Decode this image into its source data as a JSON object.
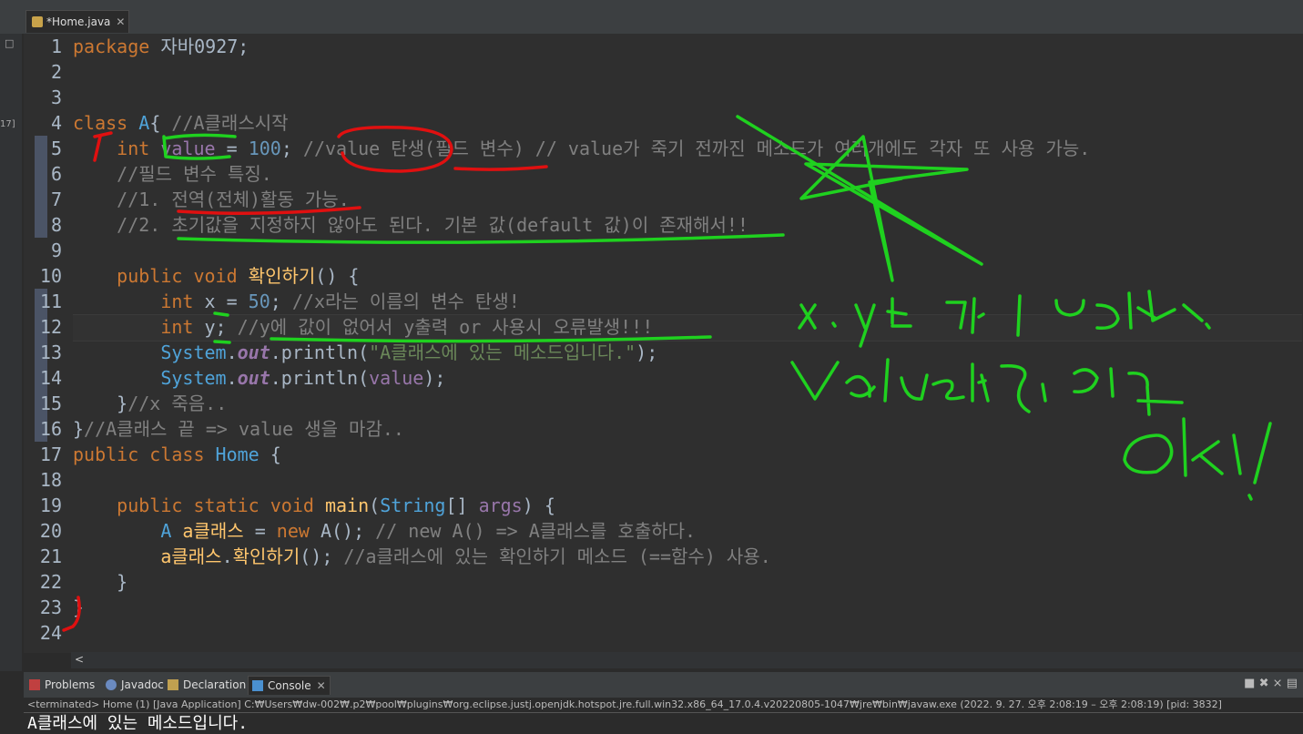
{
  "editor": {
    "tab_label": "*Home.java",
    "tab_close": "✕",
    "scroll_left": "<"
  },
  "lines": [
    {
      "n": "1",
      "parts": [
        [
          "kw",
          "package"
        ],
        [
          "loc",
          " 자바0927;"
        ]
      ]
    },
    {
      "n": "2",
      "parts": []
    },
    {
      "n": "3",
      "parts": []
    },
    {
      "n": "4",
      "parts": [
        [
          "kw",
          "class"
        ],
        [
          "loc",
          " "
        ],
        [
          "typ",
          "A"
        ],
        [
          "loc",
          "{ "
        ],
        [
          "cm",
          "//A클래스시작"
        ]
      ]
    },
    {
      "n": "5",
      "parts": [
        [
          "loc",
          "    "
        ],
        [
          "kw",
          "int"
        ],
        [
          "loc",
          " "
        ],
        [
          "fld",
          "value"
        ],
        [
          "loc",
          " = "
        ],
        [
          "num",
          "100"
        ],
        [
          "loc",
          "; "
        ],
        [
          "cm",
          "//value 탄생(필드 변수) // value가 죽기 전까진 메소드가 여러개에도 각자 또 사용 가능."
        ]
      ]
    },
    {
      "n": "6",
      "parts": [
        [
          "loc",
          "    "
        ],
        [
          "cm",
          "//필드 변수 특징."
        ]
      ]
    },
    {
      "n": "7",
      "parts": [
        [
          "loc",
          "    "
        ],
        [
          "cm",
          "//1. 전역(전체)활동 가능."
        ]
      ]
    },
    {
      "n": "8",
      "parts": [
        [
          "loc",
          "    "
        ],
        [
          "cm",
          "//2. 초기값을 지정하지 않아도 된다. 기본 값(default 값)이 존재해서!!"
        ]
      ]
    },
    {
      "n": "9",
      "parts": []
    },
    {
      "n": "10",
      "parts": [
        [
          "loc",
          "    "
        ],
        [
          "kw",
          "public void"
        ],
        [
          "loc",
          " "
        ],
        [
          "mth",
          "확인하기"
        ],
        [
          "loc",
          "() {"
        ]
      ]
    },
    {
      "n": "11",
      "parts": [
        [
          "loc",
          "        "
        ],
        [
          "kw",
          "int"
        ],
        [
          "loc",
          " x = "
        ],
        [
          "num",
          "50"
        ],
        [
          "loc",
          "; "
        ],
        [
          "cm",
          "//x라는 이름의 변수 탄생!"
        ]
      ]
    },
    {
      "n": "12",
      "parts": [
        [
          "loc",
          "        "
        ],
        [
          "kw",
          "int"
        ],
        [
          "loc",
          " y; "
        ],
        [
          "cm",
          "//y에 값이 없어서 y출력 or 사용시 오류발생!!!"
        ]
      ]
    },
    {
      "n": "13",
      "parts": [
        [
          "loc",
          "        "
        ],
        [
          "typ",
          "System"
        ],
        [
          "loc",
          "."
        ],
        [
          "stat",
          "out"
        ],
        [
          "loc",
          ".println("
        ],
        [
          "str",
          "\"A클래스에 있는 메소드입니다.\""
        ],
        [
          "loc",
          ");"
        ]
      ]
    },
    {
      "n": "14",
      "parts": [
        [
          "loc",
          "        "
        ],
        [
          "typ",
          "System"
        ],
        [
          "loc",
          "."
        ],
        [
          "stat",
          "out"
        ],
        [
          "loc",
          ".println("
        ],
        [
          "fld",
          "value"
        ],
        [
          "loc",
          ");"
        ]
      ]
    },
    {
      "n": "15",
      "parts": [
        [
          "loc",
          "    }"
        ],
        [
          "cm",
          "//x 죽음.."
        ]
      ]
    },
    {
      "n": "16",
      "parts": [
        [
          "loc",
          "}"
        ],
        [
          "cm",
          "//A클래스 끝 => value 생을 마감.."
        ]
      ]
    },
    {
      "n": "17",
      "parts": [
        [
          "kw",
          "public class"
        ],
        [
          "loc",
          " "
        ],
        [
          "typ",
          "Home"
        ],
        [
          "loc",
          " {"
        ]
      ]
    },
    {
      "n": "18",
      "parts": []
    },
    {
      "n": "19",
      "parts": [
        [
          "loc",
          "    "
        ],
        [
          "kw",
          "public static void"
        ],
        [
          "loc",
          " "
        ],
        [
          "mth",
          "main"
        ],
        [
          "loc",
          "("
        ],
        [
          "typ",
          "String"
        ],
        [
          "loc",
          "[] "
        ],
        [
          "fld",
          "args"
        ],
        [
          "loc",
          ") {"
        ]
      ]
    },
    {
      "n": "20",
      "parts": [
        [
          "loc",
          "        "
        ],
        [
          "typ",
          "A"
        ],
        [
          "loc",
          " "
        ],
        [
          "mth",
          "a클래스"
        ],
        [
          "loc",
          " = "
        ],
        [
          "kw",
          "new"
        ],
        [
          "loc",
          " A(); "
        ],
        [
          "cm",
          "// new A() => A클래스를 호출하다."
        ]
      ]
    },
    {
      "n": "21",
      "parts": [
        [
          "loc",
          "        "
        ],
        [
          "mth",
          "a클래스"
        ],
        [
          "loc",
          "."
        ],
        [
          "mth",
          "확인하기"
        ],
        [
          "loc",
          "(); "
        ],
        [
          "cm",
          "//a클래스에 있는 확인하기 메소드 (==함수) 사용."
        ]
      ]
    },
    {
      "n": "22",
      "parts": [
        [
          "loc",
          "    }"
        ]
      ]
    },
    {
      "n": "23",
      "parts": [
        [
          "loc",
          "}"
        ]
      ]
    },
    {
      "n": "24",
      "parts": []
    }
  ],
  "bottom_tabs": [
    {
      "label": "Problems",
      "icon": "problems-icon"
    },
    {
      "label": "Javadoc",
      "icon": "javadoc-icon"
    },
    {
      "label": "Declaration",
      "icon": "declaration-icon"
    },
    {
      "label": "Console",
      "icon": "console-icon"
    }
  ],
  "console": {
    "close": "✕",
    "status": "<terminated> Home (1) [Java Application] C:₩Users₩dw-002₩.p2₩pool₩plugins₩org.eclipse.justj.openjdk.hotspot.jre.full.win32.x86_64_17.0.4.v20220805-1047₩jre₩bin₩javaw.exe  (2022. 9. 27. 오후 2:08:19 – 오후 2:08:19) [pid: 3832]",
    "output": "A클래스에 있는 메소드입니다."
  },
  "left_strip": {
    "mark": "17]"
  },
  "ink_colors": {
    "green": "#1fd11f",
    "red": "#e01010"
  }
}
